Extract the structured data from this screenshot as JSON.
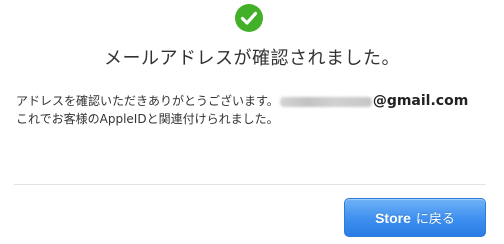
{
  "header": {
    "success_icon": "checkmark-circle-icon",
    "success_color": "#43b02a",
    "title": "メールアドレスが確認されました。"
  },
  "message": {
    "line1_prefix": "アドレスを確認いただきありがとうございます。",
    "email_local_redacted": "[blurred]",
    "email_domain": "@gmail.com",
    "line2": "これでお客様のAppleIDと関連付けられました。"
  },
  "footer": {
    "button_brand": "Store",
    "button_suffix": "に戻る",
    "button_color": "#3d8ff0"
  }
}
